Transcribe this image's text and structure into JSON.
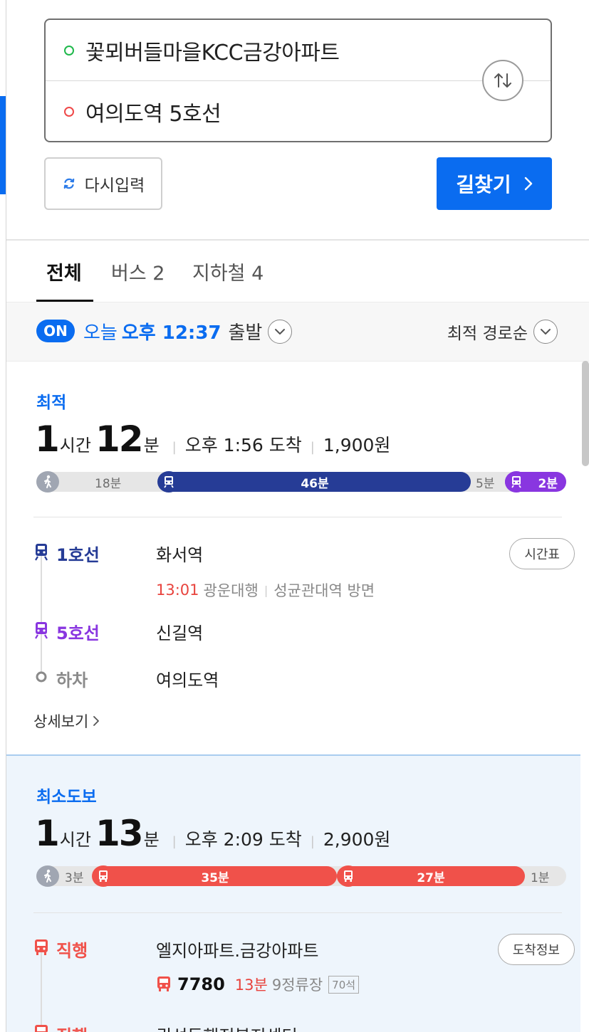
{
  "search": {
    "origin": "꽃뫼버들마을KCC금강아파트",
    "destination": "여의도역 5호선",
    "reset_label": "다시입력",
    "find_label": "길찾기"
  },
  "tabs": [
    {
      "label": "전체",
      "active": true
    },
    {
      "label": "버스 2",
      "active": false
    },
    {
      "label": "지하철 4",
      "active": false
    }
  ],
  "filter": {
    "on_badge": "ON",
    "day": "오늘",
    "time": "오후 12:37",
    "depart_label": "출발",
    "sort_label": "최적 경로순"
  },
  "routes": [
    {
      "badge": "최적",
      "hours": "1",
      "hours_unit": "시간",
      "minutes": "12",
      "minutes_unit": "분",
      "arrival": "오후 1:56 도착",
      "fare": "1,900원",
      "bar": {
        "walk_start": "18분",
        "subway_main": "46분",
        "walk_mid": "5분",
        "subway_transfer": "2분"
      },
      "legs": [
        {
          "name": "1호선",
          "station": "화서역",
          "button": "시간표",
          "sub_time": "13:01",
          "sub_dir": "광운대행",
          "sub_face": "성균관대역 방면"
        },
        {
          "name": "5호선",
          "station": "신길역"
        },
        {
          "name": "하차",
          "station": "여의도역"
        }
      ],
      "detail_label": "상세보기"
    },
    {
      "badge": "최소도보",
      "hours": "1",
      "hours_unit": "시간",
      "minutes": "13",
      "minutes_unit": "분",
      "arrival": "오후 2:09 도착",
      "fare": "2,900원",
      "bar": {
        "walk_start": "3분",
        "bus_first": "35분",
        "bus_second": "27분",
        "walk_end": "1분"
      },
      "legs": [
        {
          "name": "직행",
          "station": "엘지아파트.금강아파트",
          "button": "도착정보",
          "bus_number": "7780",
          "eta": "13분",
          "stops": "9정류장",
          "seats": "70석"
        },
        {
          "name": "직행",
          "station": "권선동행정복지센터"
        }
      ]
    }
  ],
  "colors": {
    "accent": "#0a6cf0",
    "line1": "#263c96",
    "line5": "#8936e0",
    "bus_red": "#f0514a",
    "walk": "#a0a6b2"
  }
}
